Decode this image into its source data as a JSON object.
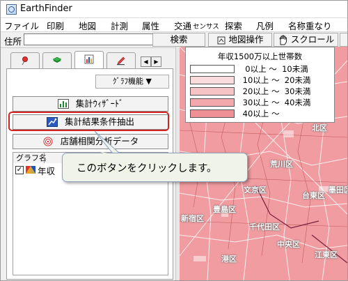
{
  "window": {
    "title": "EarthFinder"
  },
  "menu": [
    {
      "label": "ファイル",
      "small": false
    },
    {
      "label": "印刷",
      "small": false
    },
    {
      "label": "地図",
      "small": false
    },
    {
      "label": "計測",
      "small": false
    },
    {
      "label": "属性",
      "small": false
    },
    {
      "label": "交通",
      "small": false
    },
    {
      "label": "センサス",
      "small": true
    },
    {
      "label": "探索",
      "small": false
    },
    {
      "label": "凡例",
      "small": false
    },
    {
      "label": "名称重なり",
      "small": false
    }
  ],
  "toolbar": {
    "address_label": "住所",
    "address_value": "",
    "search_label": "検索",
    "map_ops_label": "地図操作",
    "scroll_label": "スクロール"
  },
  "panel": {
    "graph_function_label": "ｸﾞﾗﾌ機能 ▼",
    "tally_wizard_label": "集計ｳｨｻﾞｰﾄﾞ",
    "extract_label": "集計結果条件抽出",
    "store_label": "店舗相関分析データ",
    "list_header": "グラフ名",
    "list_items": [
      {
        "label": "年収",
        "checked": true
      }
    ]
  },
  "legend": {
    "title": "年収1500万以上世帯数",
    "rows": [
      {
        "label": "  0以上 ～  10未満",
        "color": "#ffffff"
      },
      {
        "label": " 10以上 ～  20未満",
        "color": "#fbdcdd"
      },
      {
        "label": " 20以上 ～  30未満",
        "color": "#f7c4c6"
      },
      {
        "label": " 30以上 ～  40未満",
        "color": "#f3a9ac"
      },
      {
        "label": " 40以上 ～",
        "color": "#ef9094"
      }
    ]
  },
  "map": {
    "wards": [
      "北区",
      "荒川区",
      "文京区",
      "台東区",
      "墨田区",
      "豊島区",
      "新宿区",
      "千代田区",
      "中央区",
      "江東区",
      "港区"
    ]
  },
  "callout": {
    "text": "このボタンをクリックします。"
  },
  "colors": {
    "highlight": "#d62020",
    "map_fill": "#f09ca0",
    "callout_bg": "#f0f4e8"
  }
}
